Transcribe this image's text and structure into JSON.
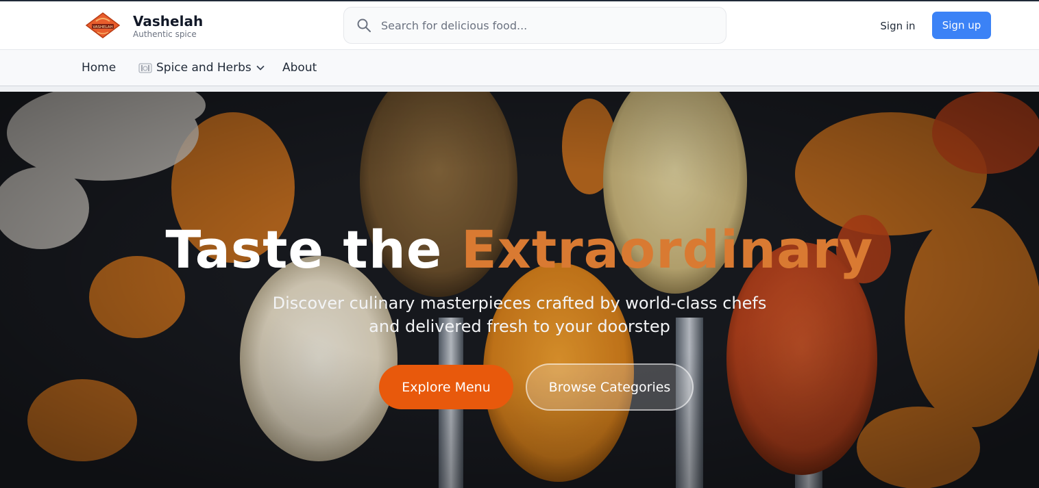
{
  "brand": {
    "name": "Vashelah",
    "tagline": "Authentic spice",
    "logo_text": "VASHELAH"
  },
  "search": {
    "placeholder": "Search for delicious food...",
    "value": "",
    "icon": "search-icon"
  },
  "auth": {
    "signin_label": "Sign in",
    "signup_label": "Sign up"
  },
  "nav": {
    "items": [
      {
        "label": "Home"
      },
      {
        "label": "Spice and Herbs",
        "icon": "plate-icon",
        "has_dropdown": true
      },
      {
        "label": "About"
      }
    ]
  },
  "hero": {
    "title_plain": "Taste the ",
    "title_accent": "Extraordinary",
    "subtitle_line1": "Discover culinary masterpieces crafted by world-class chefs",
    "subtitle_line2": "and delivered fresh to your doorstep",
    "primary_button": "Explore Menu",
    "secondary_button": "Browse Categories"
  },
  "colors": {
    "accent_blue": "#3b82f6",
    "accent_orange": "#e8590c",
    "title_accent": "#d97a32"
  }
}
